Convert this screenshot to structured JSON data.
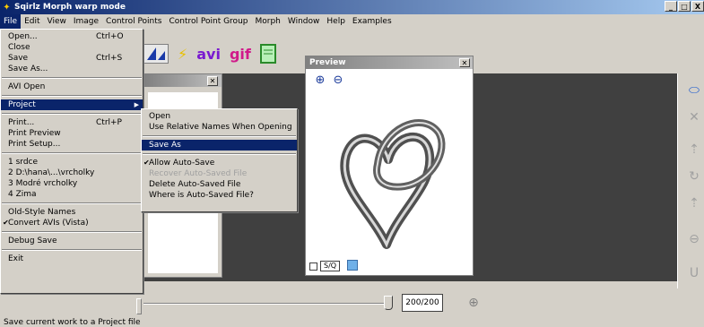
{
  "window": {
    "title": "Sqirlz Morph   warp mode",
    "controls": [
      "_",
      "□",
      "X"
    ]
  },
  "menubar": [
    "File",
    "Edit",
    "View",
    "Image",
    "Control Points",
    "Control Point Group",
    "Morph",
    "Window",
    "Help",
    "Examples"
  ],
  "toolbar": {
    "avi_label": "avi",
    "gif_label": "gif"
  },
  "file_menu": {
    "open": {
      "label": "Open...",
      "shortcut": "Ctrl+O"
    },
    "close": {
      "label": "Close"
    },
    "save": {
      "label": "Save",
      "shortcut": "Ctrl+S"
    },
    "save_as": {
      "label": "Save As..."
    },
    "avi_open": {
      "label": "AVI Open"
    },
    "project": {
      "label": "Project"
    },
    "print": {
      "label": "Print...",
      "shortcut": "Ctrl+P"
    },
    "print_preview": {
      "label": "Print Preview"
    },
    "print_setup": {
      "label": "Print Setup..."
    },
    "recent": [
      "1 srdce",
      "2 D:\\hana\\...\\vrcholky",
      "3 Modré vrcholky",
      "4 Zima"
    ],
    "old_style_names": {
      "label": "Old-Style Names"
    },
    "convert_avis": {
      "label": "Convert AVIs (Vista)"
    },
    "debug_save": {
      "label": "Debug Save"
    },
    "exit": {
      "label": "Exit"
    }
  },
  "project_submenu": {
    "open": "Open",
    "relative_names": "Use Relative Names When Opening",
    "save_as": "Save As",
    "allow_auto_save": "Allow Auto-Save",
    "recover": "Recover Auto-Saved File",
    "delete": "Delete Auto-Saved File",
    "where": "Where is Auto-Saved File?"
  },
  "preview": {
    "title": "Preview",
    "sq_label": "S/Q"
  },
  "bottom": {
    "frame": "200/200",
    "frame_value": 200,
    "frame_total": 200
  },
  "status": {
    "text": "Save current work to a Project file"
  },
  "colors": {
    "titlebar_start": "#0a246a",
    "titlebar_end": "#a6caf0",
    "selection": "#0a246a",
    "workspace": "#404040"
  }
}
